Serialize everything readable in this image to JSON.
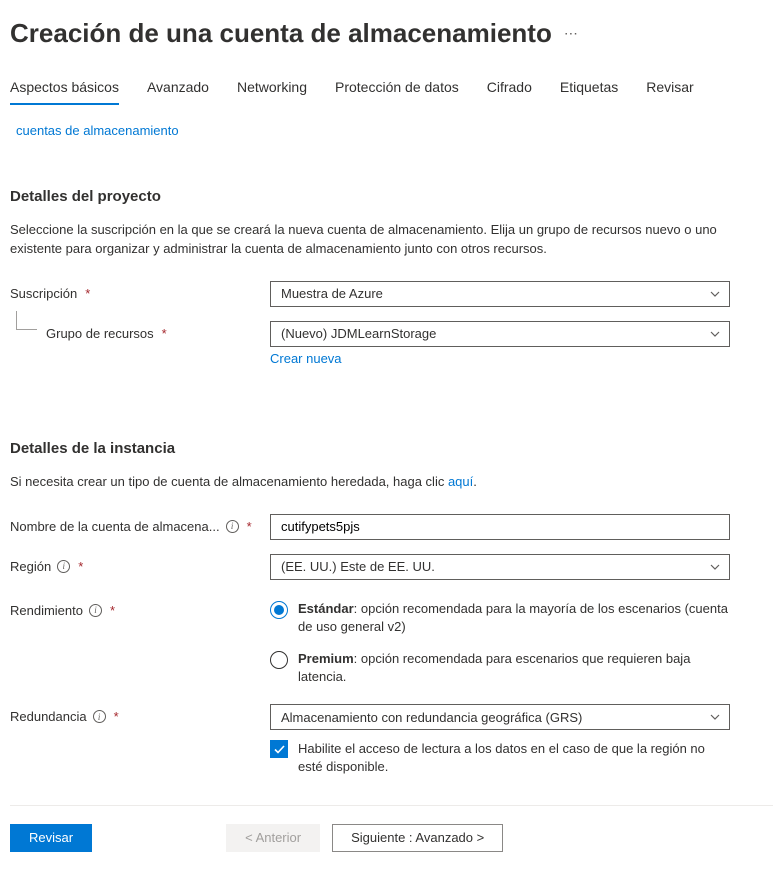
{
  "header": {
    "title": "Creación de una cuenta de almacenamiento"
  },
  "tabs": [
    {
      "label": "Aspectos básicos",
      "active": true
    },
    {
      "label": "Avanzado",
      "active": false
    },
    {
      "label": "Networking",
      "active": false
    },
    {
      "label": "Protección de datos",
      "active": false
    },
    {
      "label": "Cifrado",
      "active": false
    },
    {
      "label": "Etiquetas",
      "active": false
    },
    {
      "label": "Revisar",
      "active": false
    }
  ],
  "breadcrumb": {
    "label": "cuentas de almacenamiento"
  },
  "project": {
    "title": "Detalles del proyecto",
    "desc": "Seleccione la suscripción en la que se creará la nueva cuenta de almacenamiento. Elija un grupo de recursos nuevo o uno existente para organizar y administrar la cuenta de almacenamiento junto con otros recursos.",
    "subscription_label": "Suscripción",
    "subscription_value": "Muestra de Azure",
    "resource_group_label": "Grupo de recursos",
    "resource_group_value": "(Nuevo) JDMLearnStorage",
    "create_new": "Crear nueva"
  },
  "instance": {
    "title": "Detalles de la instancia",
    "desc_prefix": "Si necesita crear un tipo de cuenta de almacenamiento heredada, haga clic ",
    "desc_link": "aquí",
    "desc_suffix": ".",
    "name_label": "Nombre de la cuenta de almacena...",
    "name_value": "cutifypets5pjs",
    "region_label": "Región",
    "region_value": "(EE. UU.) Este de EE. UU.",
    "performance_label": "Rendimiento",
    "performance_options": [
      {
        "bold": "Estándar",
        "rest": ": opción recomendada para la mayoría de los escenarios (cuenta de uso general v2)",
        "selected": true
      },
      {
        "bold": "Premium",
        "rest": ": opción recomendada para escenarios que requieren baja latencia.",
        "selected": false
      }
    ],
    "redundancy_label": "Redundancia",
    "redundancy_value": "Almacenamiento con redundancia geográfica (GRS)",
    "read_access_checkbox": "Habilite el acceso de lectura a los datos en el caso de que la región no esté disponible."
  },
  "footer": {
    "review": "Revisar",
    "previous": "< Anterior",
    "next": "Siguiente : Avanzado >"
  }
}
